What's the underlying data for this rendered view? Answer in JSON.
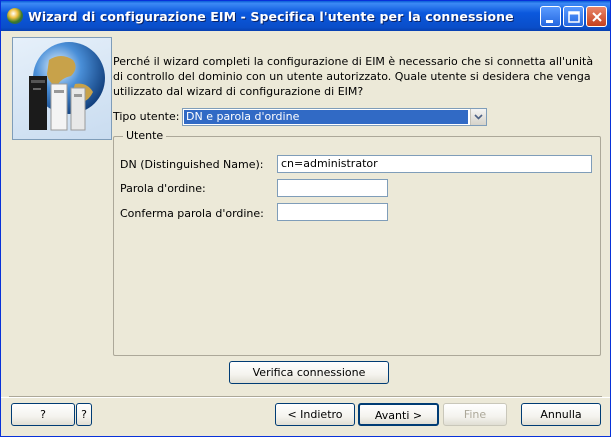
{
  "window": {
    "title": "Wizard di configurazione EIM - Specifica l'utente per la connessione"
  },
  "intro_text": "Perché il wizard completi la configurazione di EIM è necessario che si connetta all'unità di controllo del dominio con un utente autorizzato.  Quale utente si desidera che venga utilizzato dal wizard di configurazione di EIM?",
  "user_type": {
    "label": "Tipo utente:",
    "selected": "DN e parola d'ordine"
  },
  "user_group": {
    "legend": "Utente",
    "dn_label": "DN (Distinguished Name):",
    "dn_value": "cn=administrator",
    "password_label": "Parola d'ordine:",
    "password_value": "",
    "confirm_label": "Conferma parola d'ordine:",
    "confirm_value": ""
  },
  "verify_button": "Verifica connessione",
  "footer": {
    "help_label": "?",
    "whats_this_label": "?",
    "back_label": "< Indietro",
    "next_label": "Avanti >",
    "finish_label": "Fine",
    "cancel_label": "Annulla"
  }
}
